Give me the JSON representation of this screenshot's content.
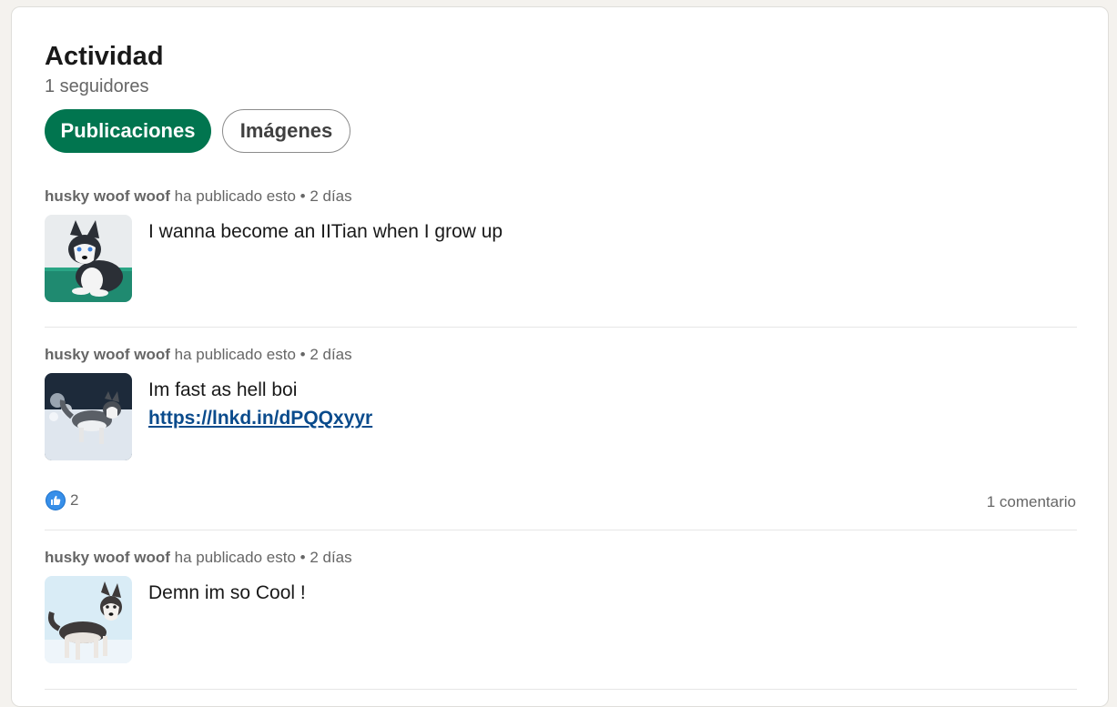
{
  "section": {
    "title": "Actividad",
    "followers": "1 seguidores"
  },
  "tabs": [
    {
      "label": "Publicaciones",
      "selected": true
    },
    {
      "label": "Imágenes",
      "selected": false
    }
  ],
  "posts": [
    {
      "author": "husky woof woof",
      "action": "ha publicado esto",
      "separator": "•",
      "time": "2 días",
      "text": "I wanna become an IITian when I grow up",
      "thumbnail": "husky-puppy-image"
    },
    {
      "author": "husky woof woof",
      "action": "ha publicado esto",
      "separator": "•",
      "time": "2 días",
      "text": "Im fast as hell boi",
      "link": "https://lnkd.in/dPQQxyyr",
      "thumbnail": "husky-running-snow-image",
      "reactions": {
        "icon": "like-icon",
        "count": "2"
      },
      "comments": "1 comentario"
    },
    {
      "author": "husky woof woof",
      "action": "ha publicado esto",
      "separator": "•",
      "time": "2 días",
      "text": "Demn im so Cool !",
      "thumbnail": "husky-snow-image"
    }
  ],
  "colors": {
    "accent": "#01754f",
    "link": "#0a4b8c",
    "like": "#378fe9"
  }
}
